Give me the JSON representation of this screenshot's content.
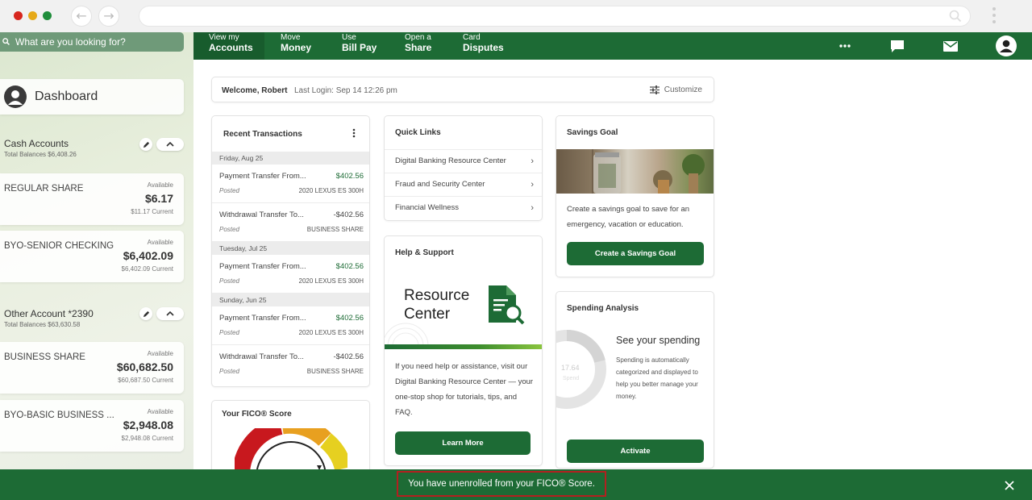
{
  "browser": {
    "back_icon": "arrow-left-icon",
    "forward_icon": "arrow-right-icon",
    "url": ""
  },
  "sidebar": {
    "search_placeholder": "What are you looking for?",
    "dashboard_title": "Dashboard",
    "groups": [
      {
        "name": "Cash Accounts",
        "total": "Total Balances $6,408.26",
        "accounts": [
          {
            "name": "REGULAR SHARE",
            "available_label": "Available",
            "balance": "$6.17",
            "current": "$11.17 Current"
          },
          {
            "name": "BYO-SENIOR CHECKING",
            "available_label": "Available",
            "balance": "$6,402.09",
            "current": "$6,402.09 Current"
          }
        ]
      },
      {
        "name": "Other Account *2390",
        "total": "Total Balances $63,630.58",
        "accounts": [
          {
            "name": "BUSINESS SHARE",
            "available_label": "Available",
            "balance": "$60,682.50",
            "current": "$60,687.50 Current"
          },
          {
            "name": "BYO-BASIC BUSINESS ...",
            "available_label": "Available",
            "balance": "$2,948.08",
            "current": "$2,948.08 Current"
          }
        ]
      }
    ]
  },
  "topnav": {
    "items": [
      {
        "small": "View my",
        "big": "Accounts",
        "active": true
      },
      {
        "small": "Move",
        "big": "Money"
      },
      {
        "small": "Use",
        "big": "Bill Pay"
      },
      {
        "small": "Open a",
        "big": "Share"
      },
      {
        "small": "Card",
        "big": "Disputes"
      }
    ]
  },
  "welcome": {
    "greeting": "Welcome, Robert",
    "last_login": "Last Login: Sep 14 12:26 pm",
    "customize": "Customize"
  },
  "recent": {
    "title": "Recent Transactions",
    "groups": [
      {
        "date": "Friday, Aug 25",
        "items": [
          {
            "desc": "Payment Transfer From...",
            "amount": "$402.56",
            "status": "Posted",
            "memo": "2020 LEXUS ES 300H"
          },
          {
            "desc": "Withdrawal Transfer To...",
            "amount": "-$402.56",
            "status": "Posted",
            "memo": "BUSINESS SHARE"
          }
        ]
      },
      {
        "date": "Tuesday, Jul 25",
        "items": [
          {
            "desc": "Payment Transfer From...",
            "amount": "$402.56",
            "status": "Posted",
            "memo": "2020 LEXUS ES 300H"
          }
        ]
      },
      {
        "date": "Sunday, Jun 25",
        "items": [
          {
            "desc": "Payment Transfer From...",
            "amount": "$402.56",
            "status": "Posted",
            "memo": "2020 LEXUS ES 300H"
          },
          {
            "desc": "Withdrawal Transfer To...",
            "amount": "-$402.56",
            "status": "Posted",
            "memo": "BUSINESS SHARE"
          }
        ]
      }
    ]
  },
  "fico": {
    "title": "Your FICO® Score",
    "gauge_colors": [
      "#c8181e",
      "#e8a020",
      "#e6d020"
    ]
  },
  "quick_links": {
    "title": "Quick Links",
    "items": [
      "Digital Banking Resource Center",
      "Fraud and Security Center",
      "Financial Wellness"
    ]
  },
  "help": {
    "title": "Help & Support",
    "banner_line1": "Resource",
    "banner_line2": "Center",
    "description": "If you need help or assistance, visit our Digital Banking Resource Center — your one-stop shop for tutorials, tips, and FAQ.",
    "button": "Learn More"
  },
  "savings": {
    "title": "Savings Goal",
    "description": "Create a savings goal to save for an emergency, vacation or education.",
    "button": "Create a Savings Goal"
  },
  "spending": {
    "title": "Spending Analysis",
    "headline": "See your spending",
    "description": "Spending is automatically categorized and displayed to help you better manage your money.",
    "donut_value": "17.64",
    "donut_label": "Spend",
    "button": "Activate"
  },
  "toast": {
    "message": "You have unenrolled from your FICO® Score."
  },
  "colors": {
    "brand_green": "#1d6b35",
    "alert_outline": "#b32020"
  }
}
